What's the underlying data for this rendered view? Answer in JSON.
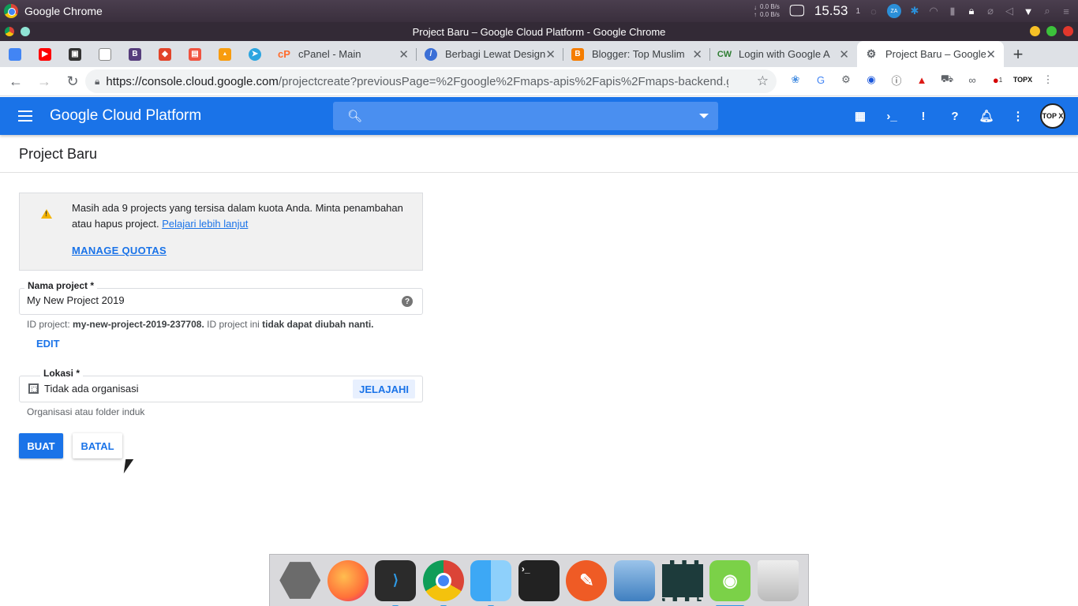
{
  "os_bar": {
    "app_name": "Google Chrome",
    "net_down": "0.0 B/s",
    "net_up": "0.0 B/s",
    "clock": "15.53",
    "workspace": "1",
    "tray_badge": "ZA"
  },
  "window": {
    "title": "Project Baru – Google Cloud Platform - Google Chrome"
  },
  "tabs": [
    {
      "label": "cPanel - Main",
      "color": "#ff6c2c"
    },
    {
      "label": "Berbagi Lewat Design",
      "color": "#3b6fd6"
    },
    {
      "label": "Blogger: Top Muslim",
      "color": "#f57d00"
    },
    {
      "label": "Login with Google A",
      "color": "#2e7d32"
    },
    {
      "label": "Project Baru – Google",
      "color": "#5f6368"
    }
  ],
  "pinned_tabs": [
    {
      "icon": "docs-icon",
      "color": "#4285f4"
    },
    {
      "icon": "youtube-icon",
      "color": "#ff0000"
    },
    {
      "icon": "app-icon",
      "color": "#333333"
    },
    {
      "icon": "file-icon",
      "color": "#888888"
    },
    {
      "icon": "bootstrap-icon",
      "color": "#563d7c"
    },
    {
      "icon": "gitlab-icon",
      "color": "#e24329"
    },
    {
      "icon": "laravel-icon",
      "color": "#f05340"
    },
    {
      "icon": "phpmyadmin-icon",
      "color": "#f89c0e"
    },
    {
      "icon": "telegram-icon",
      "color": "#2ca5e0"
    }
  ],
  "omnibox": {
    "url_host": "https://console.cloud.google.com",
    "url_rest": "/projectcreate?previousPage=%2Fgoogle%2Fmaps-apis%2Fapis%2Fmaps-backend.g..."
  },
  "extension_badge": "1",
  "gcp": {
    "title": "Google Cloud Platform",
    "avatar_text": "TOP X"
  },
  "page": {
    "title": "Project Baru"
  },
  "notice": {
    "text": "Masih ada 9 projects yang tersisa dalam kuota Anda. Minta penambahan atau hapus project.",
    "link": "Pelajari lebih lanjut",
    "action": "MANAGE QUOTAS"
  },
  "form": {
    "project_name_label": "Nama project *",
    "project_name_value": "My New Project 2019",
    "project_id_prefix": "ID project:",
    "project_id_value": "my-new-project-2019-237708.",
    "project_id_middle": "ID project ini",
    "project_id_bold": "tidak dapat diubah nanti.",
    "edit_label": "EDIT",
    "location_label": "Lokasi *",
    "location_value": "Tidak ada organisasi",
    "browse_label": "JELAJAHI",
    "location_hint": "Organisasi atau folder induk",
    "create_label": "BUAT",
    "cancel_label": "BATAL"
  },
  "dock": [
    {
      "name": "launcher",
      "color": "#6b6b6b"
    },
    {
      "name": "firefox",
      "color": "#ff7139"
    },
    {
      "name": "vscode",
      "color": "#2b2b2b"
    },
    {
      "name": "chrome",
      "color": "#4285f4"
    },
    {
      "name": "finder",
      "color": "#3da8f5"
    },
    {
      "name": "terminal",
      "color": "#222222"
    },
    {
      "name": "postman",
      "color": "#ef5b25"
    },
    {
      "name": "screenshot",
      "color": "#5a9bd5"
    },
    {
      "name": "video",
      "color": "#1d3b3b"
    },
    {
      "name": "camera",
      "color": "#7bd148"
    },
    {
      "name": "trash",
      "color": "#dcdcdc"
    }
  ]
}
